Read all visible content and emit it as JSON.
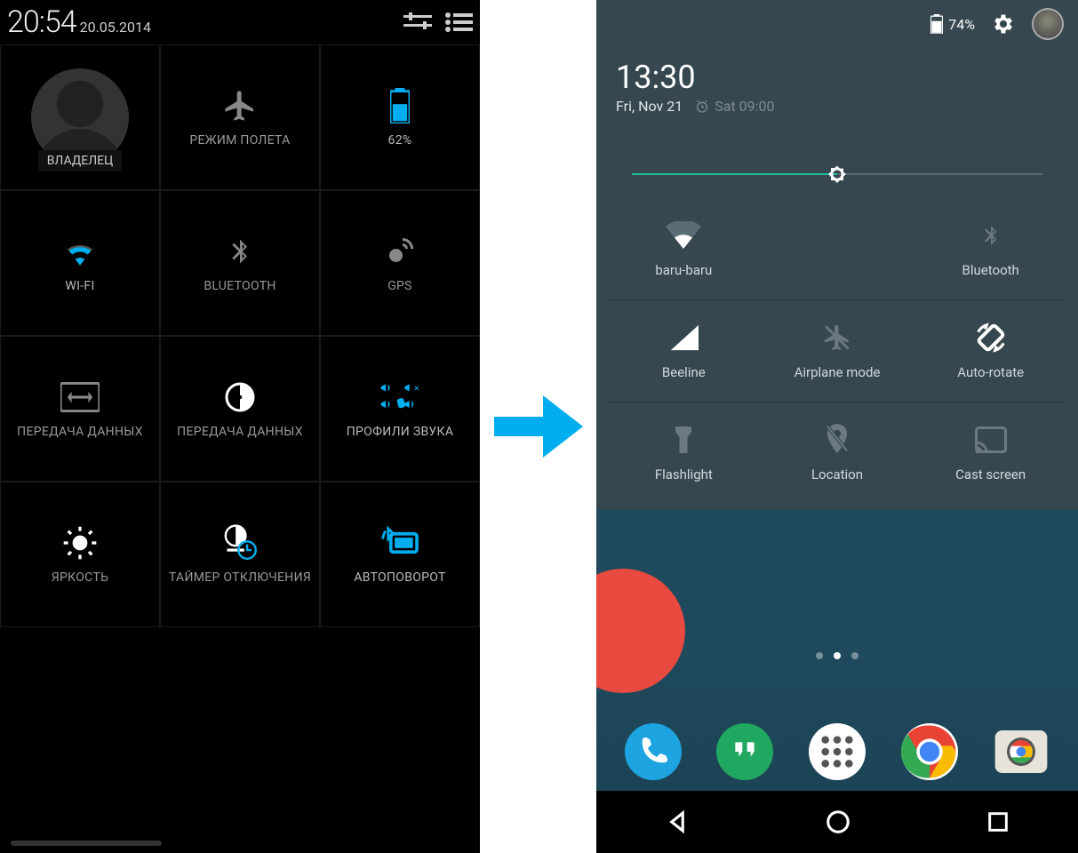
{
  "left": {
    "status": {
      "time": "20:54",
      "date": "20.05.2014"
    },
    "tiles": {
      "owner": "ВЛАДЕЛЕЦ",
      "airplane": "РЕЖИМ ПОЛЕТА",
      "battery": "62%",
      "wifi": "WI-FI",
      "bluetooth": "BLUETOOTH",
      "gps": "GPS",
      "data1": "ПЕРЕДАЧА ДАННЫХ",
      "data2": "ПЕРЕДАЧА ДАННЫХ",
      "sound": "ПРОФИЛИ ЗВУКА",
      "brightness": "ЯРКОСТЬ",
      "timer": "ТАЙМЕР ОТКЛЮЧЕНИЯ",
      "rotate": "АВТОПОВОРОТ"
    }
  },
  "right": {
    "status": {
      "battery": "74%"
    },
    "header": {
      "time": "13:30",
      "date": "Fri, Nov 21",
      "alarm": "Sat 09:00"
    },
    "brightness_pct": 50,
    "tiles": {
      "wifi": "baru-baru",
      "bluetooth": "Bluetooth",
      "signal": "Beeline",
      "airplane": "Airplane mode",
      "rotate": "Auto-rotate",
      "flashlight": "Flashlight",
      "location": "Location",
      "cast": "Cast screen"
    }
  },
  "colors": {
    "accent_blue": "#00aef0",
    "teal": "#1abc9c",
    "panel": "#37474f"
  }
}
